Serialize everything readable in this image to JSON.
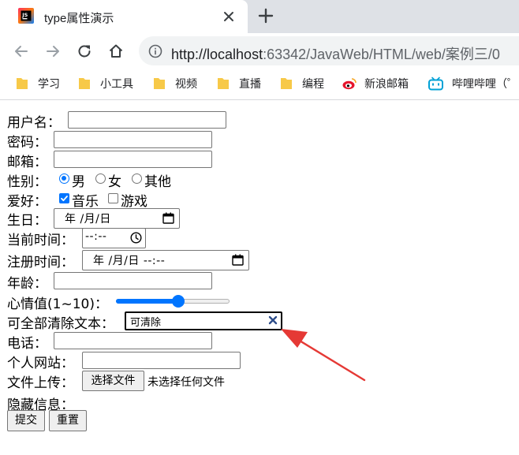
{
  "browser": {
    "tab_title": "type属性演示",
    "url_host": "http://localhost",
    "url_path": ":63342/JavaWeb/HTML/web/案例三/0",
    "bookmarks": [
      {
        "label": "学习",
        "icon": "folder-icon"
      },
      {
        "label": "小工具",
        "icon": "folder-icon"
      },
      {
        "label": "视频",
        "icon": "folder-icon"
      },
      {
        "label": "直播",
        "icon": "folder-icon"
      },
      {
        "label": "编程",
        "icon": "folder-icon"
      },
      {
        "label": "新浪邮箱",
        "icon": "weibo-icon"
      },
      {
        "label": "哔哩哔哩（゜",
        "icon": "bilibili-icon"
      }
    ],
    "colors": {
      "accent": "#0075ff",
      "tabstrip": "#dee1e6",
      "omnibox": "#f1f3f4",
      "folder": "#f7c948",
      "annotation_arrow": "#e53935"
    }
  },
  "form": {
    "username_label": "用户名：",
    "password_label": "密码：",
    "email_label": "邮箱：",
    "gender_label": "性别：",
    "gender_options": [
      {
        "label": "男",
        "checked": true
      },
      {
        "label": "女",
        "checked": false
      },
      {
        "label": "其他",
        "checked": false
      }
    ],
    "hobby_label": "爱好：",
    "hobby_options": [
      {
        "label": "音乐",
        "checked": true
      },
      {
        "label": "游戏",
        "checked": false
      }
    ],
    "birthday_label": "生日：",
    "birthday_value": "年 /月/日",
    "current_time_label": "当前时间：",
    "current_time_value": "--:--",
    "register_time_label": "注册时间：",
    "register_time_value": "年 /月/日 --:--",
    "age_label": "年龄：",
    "mood_label": "心情值(1~10)：",
    "mood_value": 6,
    "mood_min": 1,
    "mood_max": 10,
    "clearable_label": "可全部清除文本：",
    "clearable_value": "可清除",
    "phone_label": "电话：",
    "website_label": "个人网站：",
    "upload_label": "文件上传：",
    "upload_button": "选择文件",
    "upload_status": "未选择任何文件",
    "hidden_label": "隐藏信息：",
    "submit_button": "提交",
    "reset_button": "重置"
  }
}
